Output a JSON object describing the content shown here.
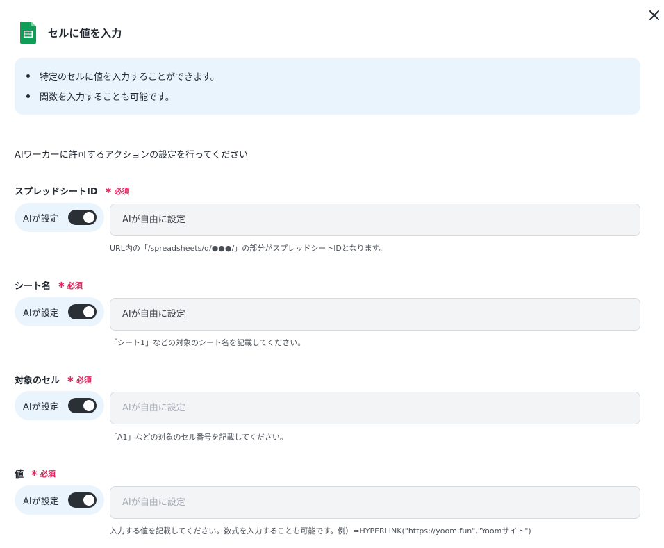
{
  "dialog": {
    "title": "セルに値を入力",
    "close_label": "×"
  },
  "info": {
    "items": [
      "特定のセルに値を入力することができます。",
      "関数を入力することも可能です。"
    ]
  },
  "lead_text": "AIワーカーに許可するアクションの設定を行ってください",
  "required_label": "必須",
  "fields": [
    {
      "label": "スプレッドシートID",
      "ai_toggle_label": "AIが設定",
      "ai_enabled": true,
      "placeholder": "AIが自由に設定",
      "hint": "URL内の「/spreadsheets/d/●●●/」の部分がスプレッドシートIDとなります。"
    },
    {
      "label": "シート名",
      "ai_toggle_label": "AIが設定",
      "ai_enabled": true,
      "placeholder": "AIが自由に設定",
      "hint": "「シート1」などの対象のシート名を記載してください。"
    },
    {
      "label": "対象のセル",
      "ai_toggle_label": "AIが設定",
      "ai_enabled": true,
      "placeholder": "AIが自由に設定",
      "hint": "「A1」などの対象のセル番号を記載してください。"
    },
    {
      "label": "値",
      "ai_toggle_label": "AIが設定",
      "ai_enabled": true,
      "placeholder": "AIが自由に設定",
      "hint": "入力する値を記載してください。数式を入力することも可能です。例）=HYPERLINK(\"https://yoom.fun\",\"Yoomサイト\")"
    }
  ],
  "colors": {
    "accent_required": "#e0245e",
    "info_background": "#eaf4fd",
    "toggle_on": "#2b2f36",
    "sheets_green": "#0f9d58"
  },
  "icons": {
    "app": "google-sheets-icon",
    "close": "close-icon"
  }
}
